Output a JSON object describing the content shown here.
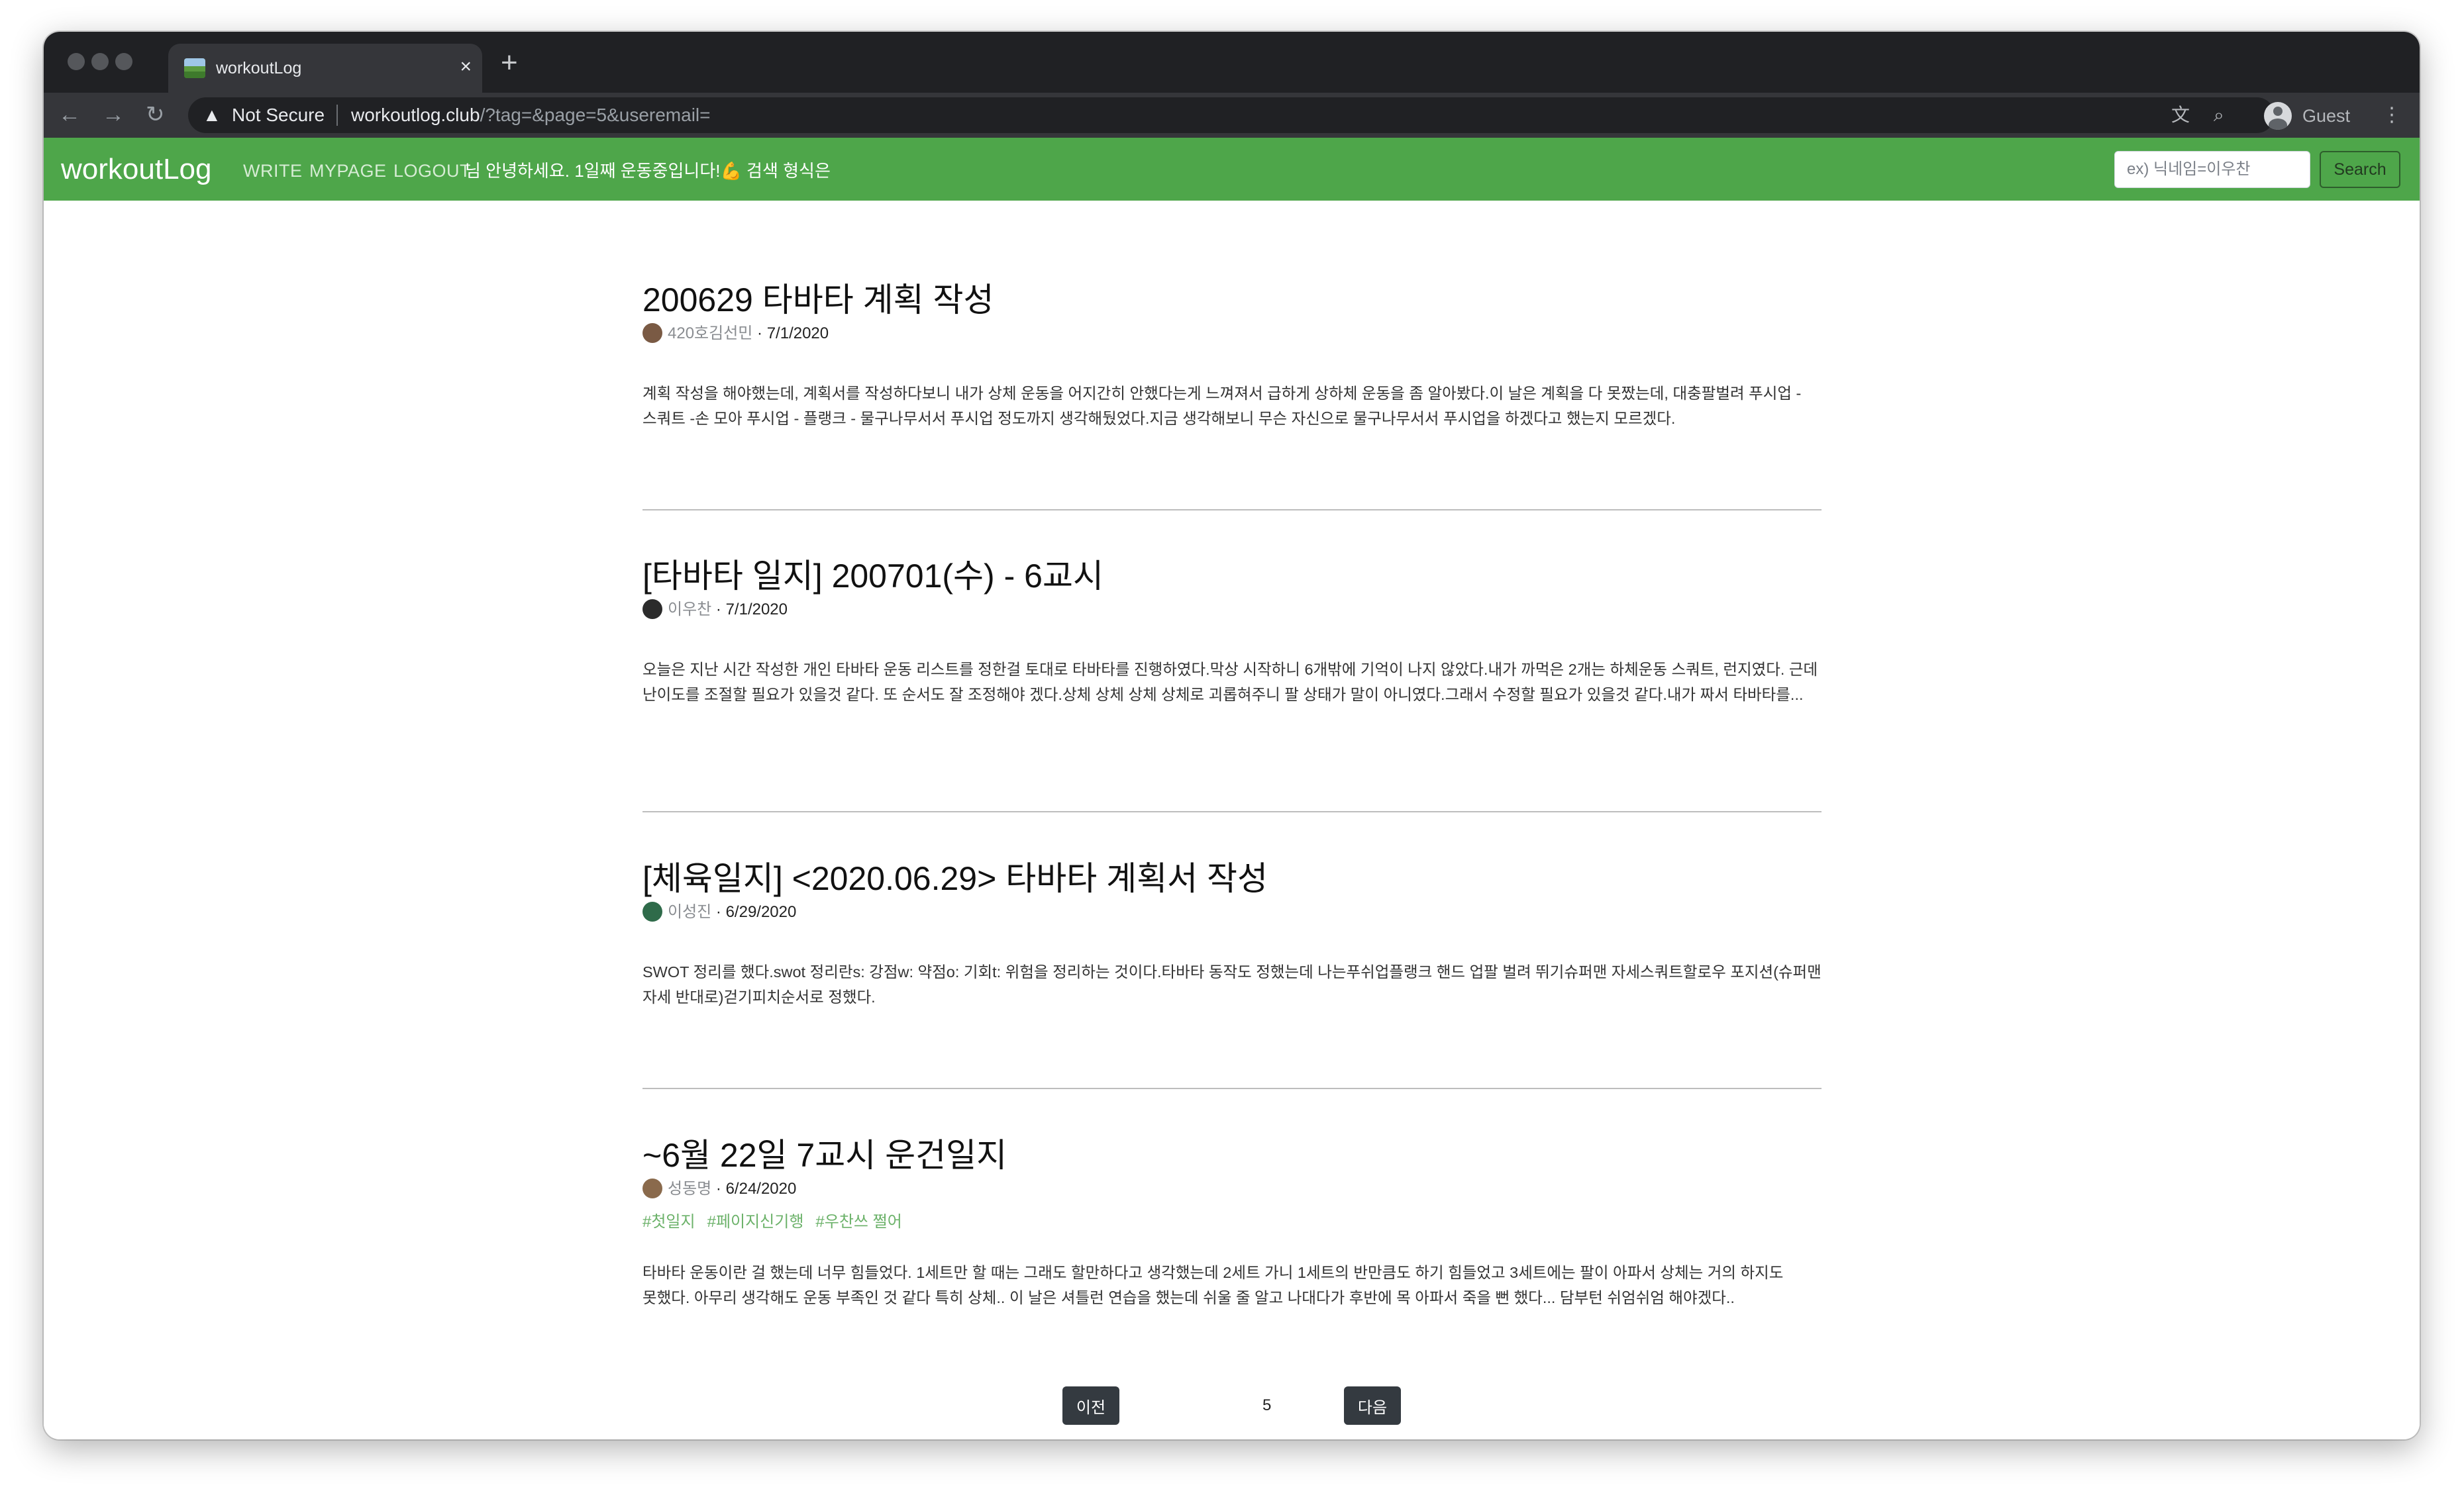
{
  "browser": {
    "tab_title": "workoutLog",
    "tab_close_glyph": "×",
    "new_tab_glyph": "+",
    "security_icon": "warning-triangle-icon",
    "security_label": "Not Secure",
    "url_host": "workoutlog.club",
    "url_path": "/?tag=&page=5&useremail=",
    "profile_label": "Guest",
    "toolbar_icons": [
      "back-arrow-icon",
      "forward-arrow-icon",
      "reload-icon",
      "translate-icon",
      "zoom-icon",
      "profile-icon",
      "kebab-menu-icon"
    ]
  },
  "nav": {
    "brand": "workoutLog",
    "links": [
      "WRITE",
      "MYPAGE",
      "LOGOUT"
    ],
    "greeting": "님 안녕하세요. 1일째 운동중입니다!💪 검색 형식은",
    "search_placeholder": "ex) 닉네임=이우찬",
    "search_button": "Search",
    "bar_color": "#4ea64a"
  },
  "posts": [
    {
      "title": "200629 타바타 계획 작성",
      "author": "420호김선민",
      "date": "7/1/2020",
      "avatar_color": "#7a5a44",
      "tags": [],
      "excerpt": "계획 작성을 해야했는데, 계획서를 작성하다보니 내가 상체 운동을 어지간히 안했다는게 느껴져서 급하게 상하체 운동을 좀 알아봤다.이 날은 계획을 다 못짰는데, 대충팔벌려 푸시업 - 스쿼트 -손 모아 푸시업 - 플랭크 - 물구나무서서 푸시업 정도까지 생각해뒀었다.지금 생각해보니 무슨 자신으로 물구나무서서 푸시업을 하겠다고 했는지 모르겠다."
    },
    {
      "title": "[타바타 일지] 200701(수) - 6교시",
      "author": "이우찬",
      "date": "7/1/2020",
      "avatar_color": "#2b2b2b",
      "tags": [],
      "excerpt": "오늘은 지난 시간 작성한 개인 타바타 운동 리스트를 정한걸 토대로 타바타를 진행하였다.막상 시작하니 6개밖에 기억이 나지 않았다.내가 까먹은 2개는 하체운동 스쿼트, 런지였다. 근데 난이도를 조절할 필요가 있을것 같다. 또 순서도 잘 조정해야 겠다.상체 상체 상체 상체로 괴롭혀주니 팔 상태가 말이 아니였다.그래서 수정할 필요가 있을것 같다.내가 짜서 타바타를..."
    },
    {
      "title": "[체육일지] <2020.06.29> 타바타 계획서 작성",
      "author": "이성진",
      "date": "6/29/2020",
      "avatar_color": "#2f6b4a",
      "tags": [],
      "excerpt": " SWOT 정리를 했다.swot 정리란s: 강점w: 약점o: 기회t: 위험을 정리하는 것이다.타바타 동작도 정했는데 나는푸쉬업플랭크 핸드 업팔 벌려 뛰기슈퍼맨 자세스쿼트할로우 포지션(슈퍼맨 자세 반대로)걷기피치순서로 정했다."
    },
    {
      "title": "~6월 22일 7교시 운건일지",
      "author": "성동명",
      "date": "6/24/2020",
      "avatar_color": "#8a6a4c",
      "tags": [
        "#첫일지",
        "#페이지신기행",
        "#우찬쓰 쩔어"
      ],
      "excerpt": "타바타 운동이란 걸 했는데 너무 힘들었다. 1세트만 할 때는 그래도 할만하다고 생각했는데 2세트 가니 1세트의 반만큼도 하기 힘들었고 3세트에는 팔이 아파서 상체는 거의 하지도 못했다. 아무리 생각해도 운동 부족인 것 같다 특히 상체.. 이 날은 셔틀런 연습을 했는데 쉬울 줄 알고 나대다가 후반에 목 아파서 죽을 뻔 했다... 담부턴 쉬엄쉬엄 해야겠다.."
    }
  ],
  "pagination": {
    "prev": "이전",
    "current": "5",
    "next": "다음"
  }
}
